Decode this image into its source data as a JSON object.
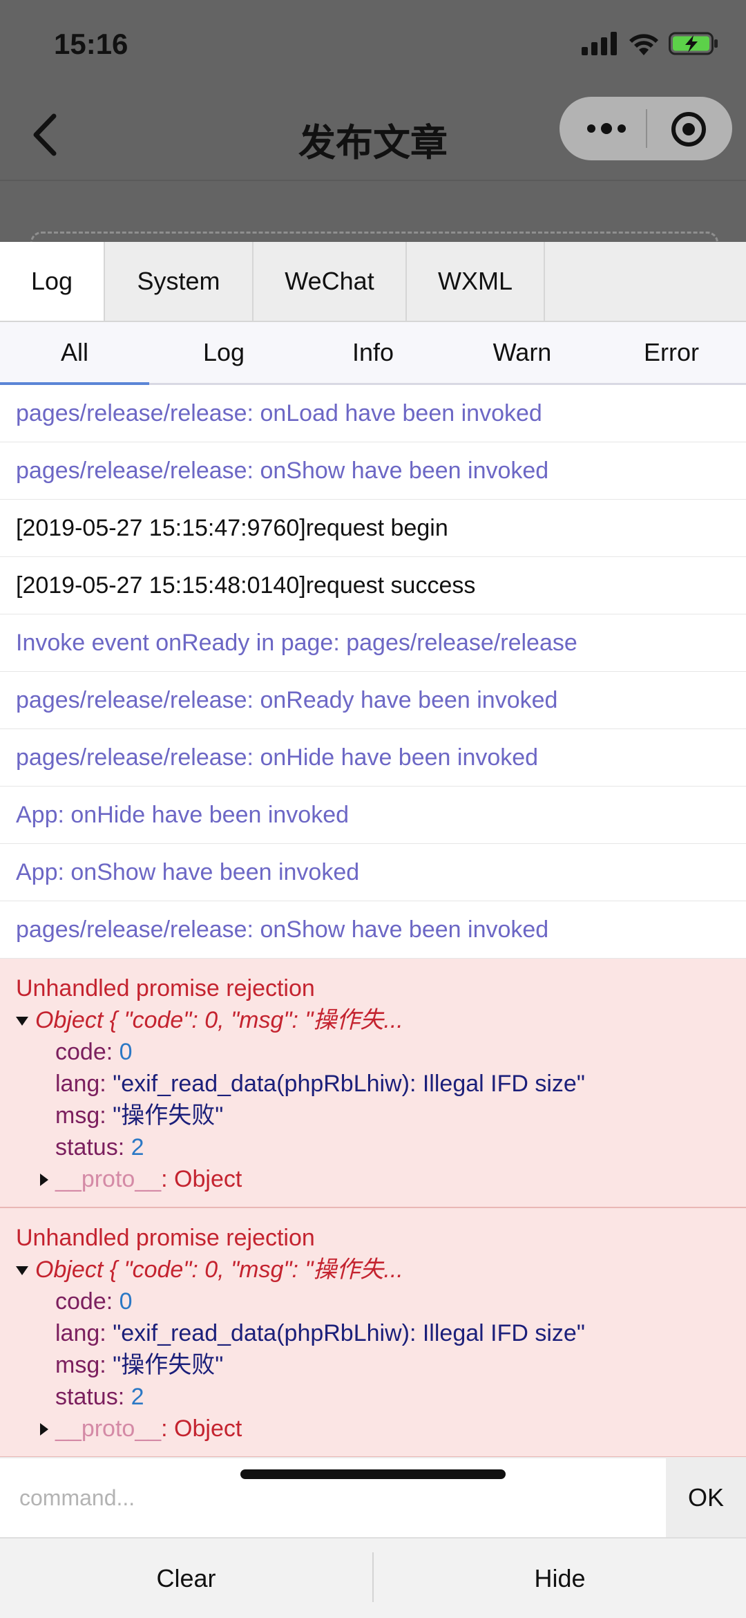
{
  "status_bar": {
    "time": "15:16"
  },
  "nav": {
    "title": "发布文章"
  },
  "tabs": [
    {
      "label": "Log",
      "active": true
    },
    {
      "label": "System",
      "active": false
    },
    {
      "label": "WeChat",
      "active": false
    },
    {
      "label": "WXML",
      "active": false
    }
  ],
  "subtabs": [
    {
      "label": "All",
      "active": true
    },
    {
      "label": "Log",
      "active": false
    },
    {
      "label": "Info",
      "active": false
    },
    {
      "label": "Warn",
      "active": false
    },
    {
      "label": "Error",
      "active": false
    }
  ],
  "logs": [
    "pages/release/release: onLoad have been invoked",
    "pages/release/release: onShow have been invoked",
    "[2019-05-27 15:15:47:9760]request begin",
    "[2019-05-27 15:15:48:0140]request success",
    "Invoke event onReady in page: pages/release/release",
    "pages/release/release: onReady have been invoked",
    "pages/release/release: onHide have been invoked",
    "App: onHide have been invoked",
    "App: onShow have been invoked",
    "pages/release/release: onShow have been invoked"
  ],
  "errors": [
    {
      "title": "Unhandled promise rejection",
      "object": "Object { \"code\": 0, \"msg\": \"操作失...",
      "code_key": "code: ",
      "code_val": "0",
      "lang_key": "lang: ",
      "lang_val": "\"exif_read_data(phpRbLhiw): Illegal IFD size\"",
      "msg_key": "msg: ",
      "msg_val": "\"操作失败\"",
      "status_key": "status: ",
      "status_val": "2",
      "proto_key": "__proto__",
      "proto_val": ": Object"
    },
    {
      "title": "Unhandled promise rejection",
      "object": "Object { \"code\": 0, \"msg\": \"操作失...",
      "code_key": "code: ",
      "code_val": "0",
      "lang_key": "lang: ",
      "lang_val": "\"exif_read_data(phpRbLhiw): Illegal IFD size\"",
      "msg_key": "msg: ",
      "msg_val": "\"操作失败\"",
      "status_key": "status: ",
      "status_val": "2",
      "proto_key": "__proto__",
      "proto_val": ": Object"
    }
  ],
  "command": {
    "placeholder": "command...",
    "ok_label": "OK"
  },
  "bottom": {
    "clear_label": "Clear",
    "hide_label": "Hide"
  }
}
